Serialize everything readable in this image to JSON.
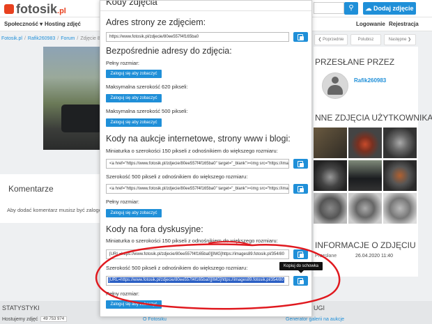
{
  "header": {
    "logo_text": "fotosik",
    "logo_tld": ".pl",
    "add_photo_label": "Dodaj zdjęcie",
    "search_icon": "search-icon",
    "upload_icon": "cloud-upload-icon"
  },
  "nav": {
    "left": [
      "Społeczność ▾",
      "Hosting zdjęć"
    ],
    "right": [
      "Logowanie",
      "Rejestracja"
    ]
  },
  "breadcrumb": [
    "Fotosik.pl",
    "Rafik260983",
    "Forum",
    "Zdjęcie 80ee557"
  ],
  "pager": {
    "prev": "❮ Poprzednie",
    "like": "Polubisz",
    "next": "Następne ❯"
  },
  "comments": {
    "title": "Komentarze",
    "login_note": "Aby dodać komentarz musisz być zalogowa"
  },
  "sidebar": {
    "uploaded_by_title": "PRZESŁANE PRZEZ",
    "username": "Rafik260983",
    "other_photos_title": "NNE ZDJĘCIA UŻYTKOWNIKA",
    "info_title": "INFORMACJE O ZDJĘCIU",
    "info_label": "Przesłane",
    "info_value": "26.04.2020 11:40"
  },
  "footer": {
    "stats_title": "STATYSTYKI",
    "stats_row_label": "Hostujemy zdjęć",
    "stats_row_value": "49 753 974",
    "link_about": "O Fotosiku",
    "link_generator": "Generator galerii na aukcje",
    "right_title": "UGI"
  },
  "modal": {
    "title": "Kody zdjęcia",
    "page_address_heading": "Adres strony ze zdjęciem:",
    "page_address_value": "https://www.fotosik.pl/zdjecie/80ee557f4f165ba0",
    "direct_heading": "Bezpośrednie adresy do zdjęcia:",
    "full_size_label": "Pełny rozmiar:",
    "max620_label": "Maksymalna szerokość 620 pikseli:",
    "max500_label": "Maksymalna szerokość 500 pikseli:",
    "login_to_see": "Zaloguj się aby zobaczyć",
    "auction_heading": "Kody na aukcje internetowe, strony www i blogi:",
    "thumb150_label": "Miniaturka o szerokości 150 pikseli z odnośnikiem do większego rozmiaru:",
    "thumb150_code": "<a href=\"https://www.fotosik.pl/zdjecie/80ee557f4f165ba0\" target=\"_blank\"><img src=\"https://ima",
    "w500_label": "Szerokość 500 pikseli z odnośnikiem do większego rozmiaru:",
    "w500_code": "<a href=\"https://www.fotosik.pl/zdjecie/80ee557f4f165ba0\" target=\"_blank\"><img src=\"https://ima",
    "full_size_label2": "Pełny rozmiar:",
    "forum_heading": "Kody na fora dyskusyjne:",
    "forum_thumb_label": "Miniaturka o szerokości 150 pikseli z odnośnikiem do większego rozmiaru:",
    "forum_thumb_code": "[URL=https://www.fotosik.pl/zdjecie/80ee557f4f165ba0][IMG]https://images89.fotosik.pl/354/80",
    "forum_w500_label": "Szerokość 500 pikseli z odnośnikiem do większego rozmiaru:",
    "forum_w500_code": "[URL=https://www.fotosik.pl/zdjecie/80ee557f4f165ba0][IMG]https://images89.fotosik.pl/354/80",
    "forum_full_label": "Pełny rozmiar:",
    "copy_tooltip": "Kopiuj do schowka"
  },
  "colors": {
    "accent": "#1f8fd8",
    "annotation": "#e0191f",
    "selection": "#2b5fc4"
  }
}
